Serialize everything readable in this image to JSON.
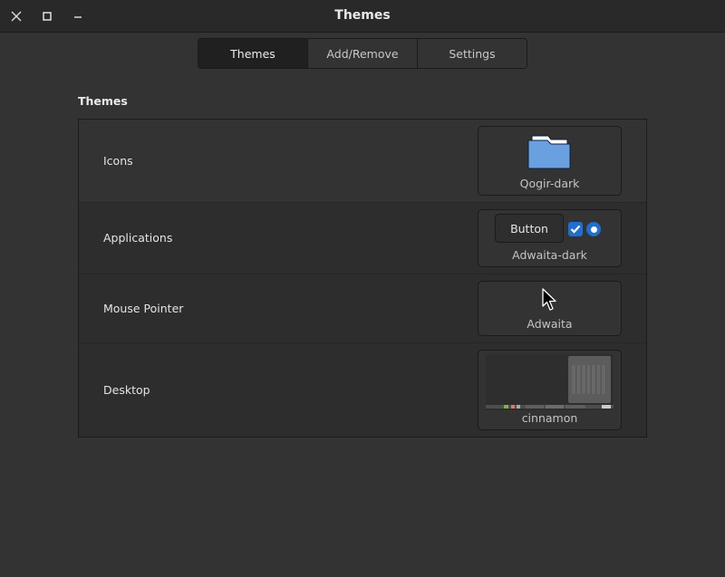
{
  "window": {
    "title": "Themes",
    "controls": {
      "close": "close-icon",
      "maximize": "maximize-icon",
      "minimize": "minimize-icon"
    }
  },
  "tabs": [
    {
      "label": "Themes",
      "active": true
    },
    {
      "label": "Add/Remove",
      "active": false
    },
    {
      "label": "Settings",
      "active": false
    }
  ],
  "section": {
    "title": "Themes"
  },
  "rows": [
    {
      "label": "Icons",
      "value": "Qogir-dark",
      "preview": "folder-icon"
    },
    {
      "label": "Applications",
      "value": "Adwaita-dark",
      "preview": "widgets",
      "preview_button_label": "Button",
      "preview_checkbox_checked": true,
      "preview_radio_selected": true
    },
    {
      "label": "Mouse Pointer",
      "value": "Adwaita",
      "preview": "pointer-arrow-icon"
    },
    {
      "label": "Desktop",
      "value": "cinnamon",
      "preview": "desktop-screenshot"
    }
  ],
  "colors": {
    "accent": "#1f6fd0",
    "folder": "#6a9fe0",
    "background": "#333333",
    "titlebar": "#292929"
  }
}
